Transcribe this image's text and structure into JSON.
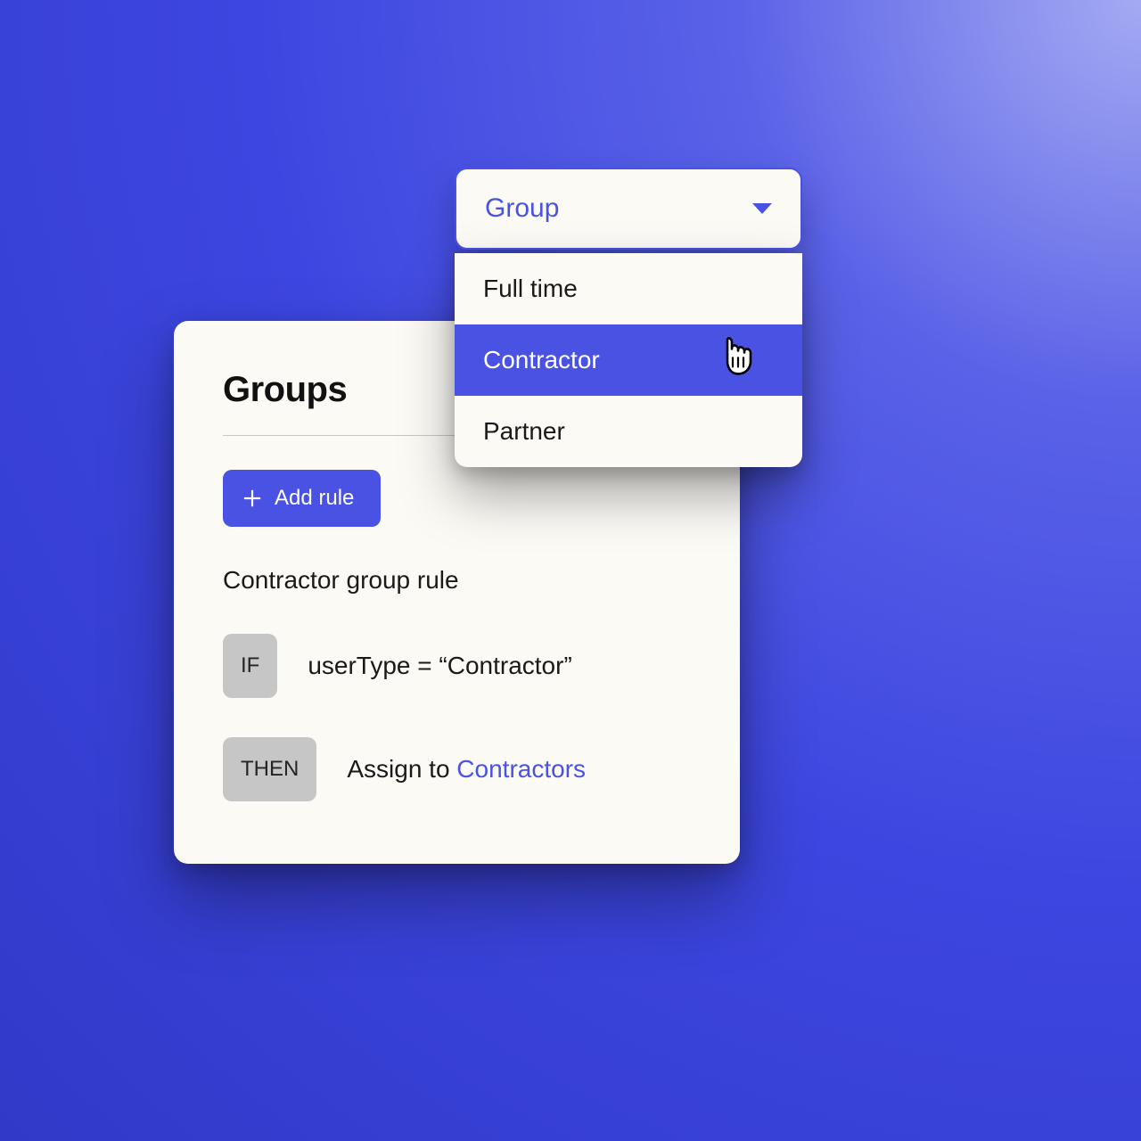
{
  "card": {
    "title": "Groups",
    "add_rule_label": "Add rule",
    "rule_title": "Contractor group rule",
    "if_label": "IF",
    "then_label": "THEN",
    "if_expression": "userType = “Contractor”",
    "then_prefix": "Assign to ",
    "then_link": "Contractors"
  },
  "select": {
    "label": "Group",
    "options": [
      "Full time",
      "Contractor",
      "Partner"
    ],
    "hover_index": 1
  }
}
